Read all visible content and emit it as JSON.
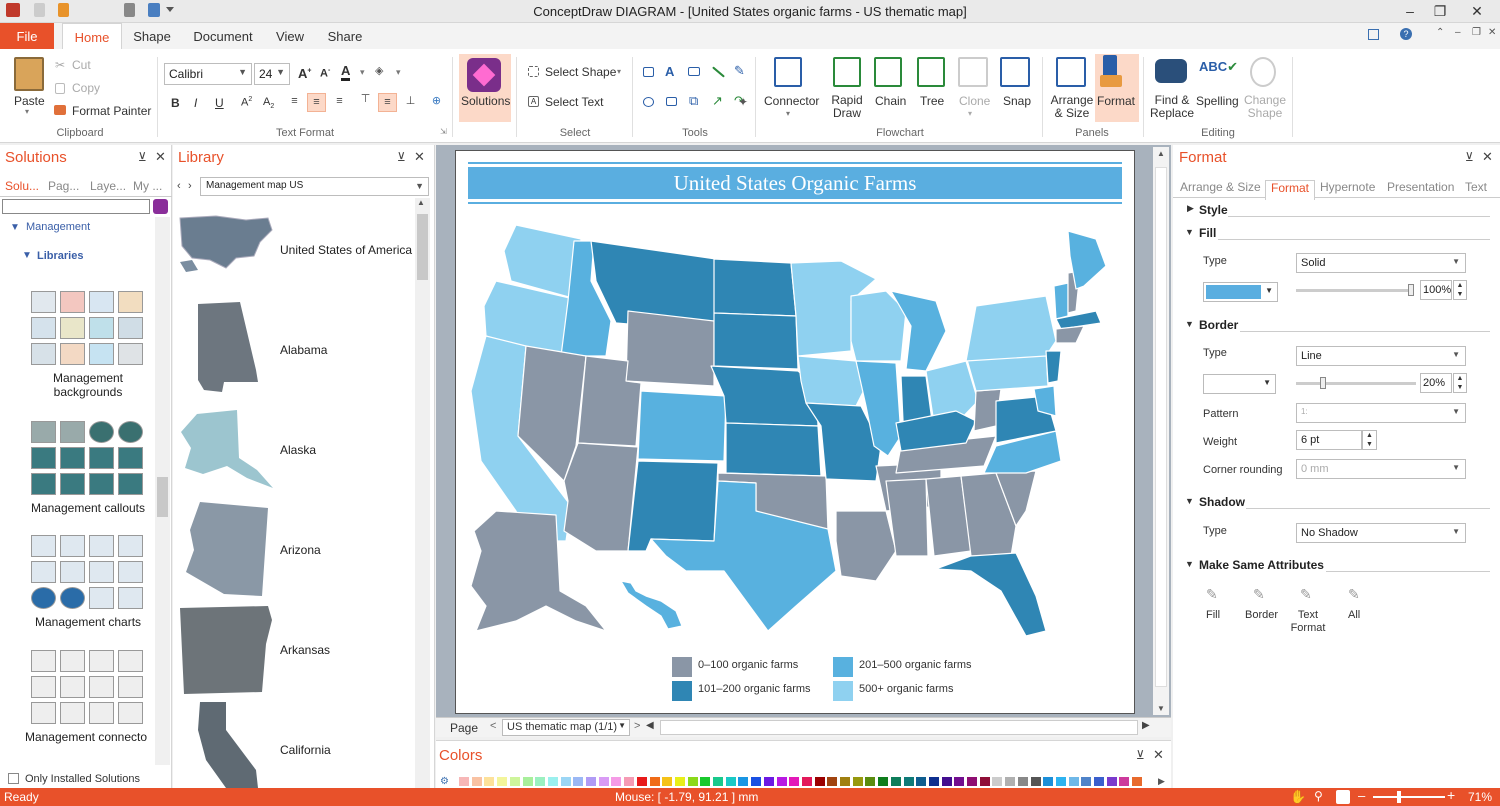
{
  "window": {
    "title": "ConceptDraw DIAGRAM - [United States organic farms - US thematic map]"
  },
  "tabs": [
    "File",
    "Home",
    "Shape",
    "Document",
    "View",
    "Share"
  ],
  "ribbon": {
    "clipboard": {
      "paste": "Paste",
      "cut": "Cut",
      "copy": "Copy",
      "format_painter": "Format Painter",
      "group": "Clipboard"
    },
    "text_format": {
      "font": "Calibri",
      "size": "24",
      "group": "Text Format"
    },
    "solutions": "Solutions",
    "select": {
      "select_shape": "Select Shape",
      "select_text": "Select Text",
      "group": "Select"
    },
    "tools_group": "Tools",
    "flowchart": {
      "connector": "Connector",
      "rapid_draw": "Rapid Draw",
      "chain": "Chain",
      "tree": "Tree",
      "clone": "Clone",
      "snap": "Snap",
      "group": "Flowchart"
    },
    "panels": {
      "arrange": "Arrange & Size",
      "format": "Format",
      "group": "Panels"
    },
    "editing": {
      "find": "Find & Replace",
      "spelling": "Spelling",
      "change_shape": "Change Shape",
      "group": "Editing"
    }
  },
  "solutions_panel": {
    "title": "Solutions",
    "tabs": [
      "Solu...",
      "Pag...",
      "Laye...",
      "My ..."
    ],
    "tree": {
      "management": "Management",
      "libraries": "Libraries"
    },
    "libraries": [
      "Management backgrounds",
      "Management callouts",
      "Management charts",
      "Management connecto"
    ],
    "only_installed": "Only Installed Solutions"
  },
  "library_panel": {
    "title": "Library",
    "selected": "Management map US",
    "items": [
      "United States of America",
      "Alabama",
      "Alaska",
      "Arizona",
      "Arkansas",
      "California"
    ]
  },
  "canvas": {
    "map_title": "United States Organic Farms",
    "legend": [
      {
        "label": "0–100 organic farms",
        "color": "#8a96a6"
      },
      {
        "label": "201–500 organic farms",
        "color": "#58b1df"
      },
      {
        "label": "101–200 organic farms",
        "color": "#2f86b4"
      },
      {
        "label": "500+ organic farms",
        "color": "#8fd1f0"
      }
    ],
    "page_label": "Page",
    "page_combo": "US thematic map (1/1)"
  },
  "colors_panel": {
    "title": "Colors",
    "swatches": [
      "#f7b7b7",
      "#f9c2a3",
      "#fde19a",
      "#f3f59b",
      "#cef59b",
      "#a8ef9b",
      "#9bf0c0",
      "#9bf0ee",
      "#9bd6f5",
      "#9bb8f5",
      "#b09bf5",
      "#d99bf5",
      "#f59be6",
      "#f59bb4",
      "#e81a1a",
      "#f06b17",
      "#f5c218",
      "#e8ef19",
      "#8bd91a",
      "#19c92d",
      "#19c98c",
      "#19c9c5",
      "#1996e3",
      "#1950e3",
      "#6b19e3",
      "#b819e3",
      "#e319b8",
      "#e3195a",
      "#9b0000",
      "#a14410",
      "#a08010",
      "#97990e",
      "#5a8c0e",
      "#0e7d1c",
      "#0e7d5a",
      "#0e7a78",
      "#0e5d8f",
      "#0e2f8f",
      "#430e8f",
      "#720e8f",
      "#8f0e72",
      "#8f0e37",
      "#cccccc",
      "#b0b0b0",
      "#888888",
      "#555555",
      "#1c8fd9",
      "#2db3f0",
      "#6fb8e8",
      "#4f83c9",
      "#3a5fcd",
      "#7a3acd",
      "#cd3a9c",
      "#e86a2d"
    ]
  },
  "format_panel": {
    "title": "Format",
    "tabs": [
      "Arrange & Size",
      "Format",
      "Hypernote",
      "Presentation",
      "Text"
    ],
    "style": "Style",
    "fill": {
      "section": "Fill",
      "type_label": "Type",
      "type": "Solid",
      "opacity": "100%",
      "color": "#5aaee0"
    },
    "border": {
      "section": "Border",
      "type_label": "Type",
      "type": "Line",
      "opacity": "20%",
      "pattern_label": "Pattern",
      "pattern": "1:",
      "weight_label": "Weight",
      "weight": "6 pt",
      "corner_label": "Corner rounding",
      "corner": "0 mm"
    },
    "shadow": {
      "section": "Shadow",
      "type_label": "Type",
      "type": "No Shadow"
    },
    "same_attr": {
      "section": "Make Same Attributes",
      "fill": "Fill",
      "border": "Border",
      "text_format": "Text Format",
      "all": "All"
    }
  },
  "status": {
    "ready": "Ready",
    "mouse": "Mouse: [ -1.79, 91.21 ] mm",
    "zoom": "71%"
  }
}
